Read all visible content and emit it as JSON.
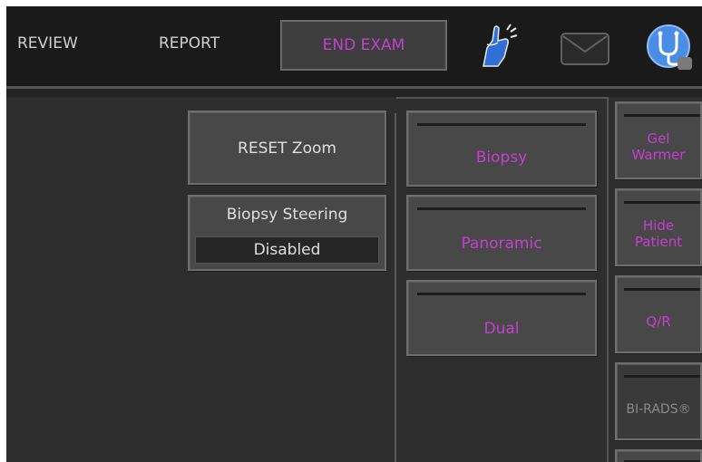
{
  "topbar": {
    "review_label": "REVIEW",
    "report_label": "REPORT",
    "end_exam_label": "END EXAM"
  },
  "icons": {
    "touch": "touch-gesture-icon",
    "mail": "mail-icon",
    "stethoscope": "stethoscope-icon"
  },
  "controls": {
    "reset_zoom_label": "RESET Zoom",
    "biopsy_steering_label": "Biopsy Steering",
    "biopsy_steering_value": "Disabled"
  },
  "modes": [
    {
      "label": "Biopsy"
    },
    {
      "label": "Panoramic"
    },
    {
      "label": "Dual"
    }
  ],
  "side_buttons": [
    {
      "line1": "Gel",
      "line2": "Warmer"
    },
    {
      "line1": "Hide",
      "line2": "Patient"
    },
    {
      "line1": "Q/R",
      "line2": ""
    },
    {
      "line1": "BI-RADS®",
      "line2": ""
    }
  ],
  "colors": {
    "accent": "#c53fd1",
    "background": "#2e2e2e",
    "topbar": "#1a1a1a",
    "button": "#484848"
  }
}
